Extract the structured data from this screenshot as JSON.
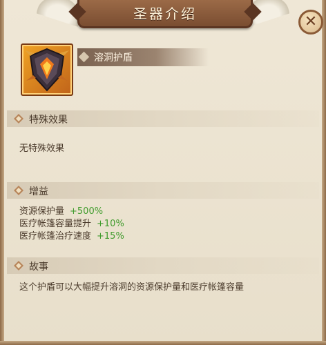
{
  "title": "圣器介绍",
  "close": {
    "icon": "close-icon",
    "glyph": "✕"
  },
  "item": {
    "name": "溶洞护盾",
    "icon": "shield-icon"
  },
  "sections": {
    "special": {
      "title": "特殊效果",
      "text": "无特殊效果"
    },
    "bonus": {
      "title": "增益",
      "rows": [
        {
          "label": "资源保护量",
          "value": "+500%"
        },
        {
          "label": "医疗帐篷容量提升",
          "value": "+10%"
        },
        {
          "label": "医疗帐篷治疗速度",
          "value": "+15%"
        }
      ]
    },
    "story": {
      "title": "故事",
      "text": "这个护盾可以大幅提升溶洞的资源保护量和医疗帐篷容量"
    }
  },
  "colors": {
    "accent_green": "#3f9b2c",
    "title_bar": "#7a4d31",
    "panel": "#e9e1cf"
  }
}
